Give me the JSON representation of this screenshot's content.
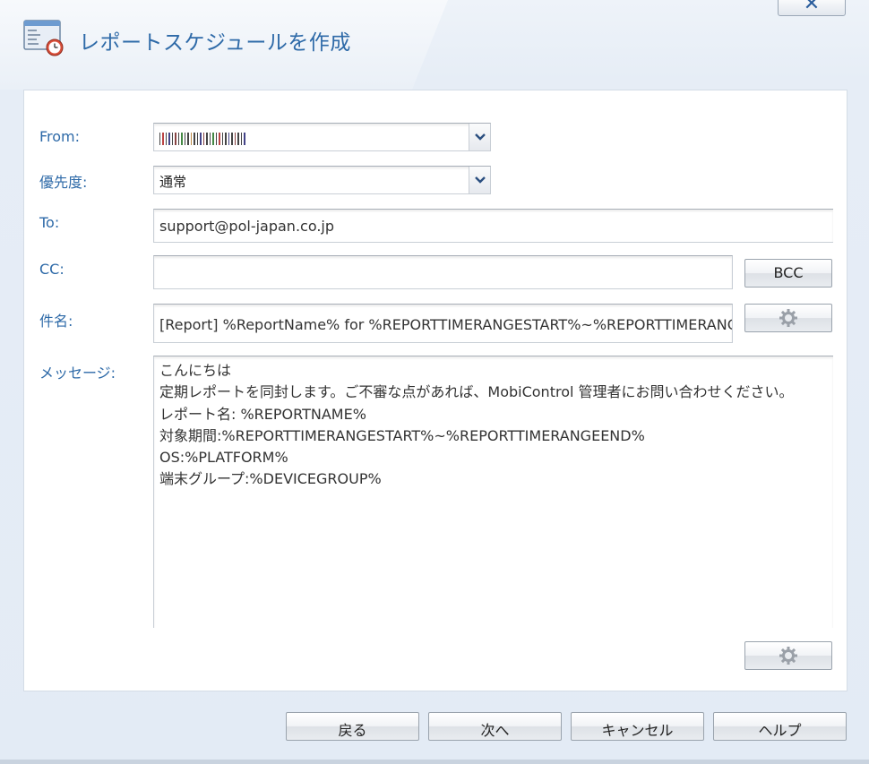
{
  "dialog": {
    "title": "レポートスケジュールを作成",
    "close_label": "✕"
  },
  "form": {
    "from_label": "From:",
    "from_value": "",
    "priority_label": "優先度:",
    "priority_value": "通常",
    "to_label": "To:",
    "to_value": "support@pol-japan.co.jp",
    "cc_label": "CC:",
    "cc_value": "",
    "bcc_button": "BCC",
    "subject_label": "件名:",
    "subject_value": "[Report] %ReportName% for %REPORTTIMERANGESTART%~%REPORTTIMERANGEEND%",
    "message_label": "メッセージ:",
    "message_lines": [
      "こんにちは",
      "定期レポートを同封します。ご不審な点があれば、MobiControl 管理者にお問い合わせください。",
      "レポート名: %REPORTNAME%",
      "対象期間:%REPORTTIMERANGESTART%~%REPORTTIMERANGEEND%",
      "OS:%PLATFORM%",
      "端末グループ:%DEVICEGROUP%"
    ]
  },
  "footer": {
    "back": "戻る",
    "next": "次へ",
    "cancel": "キャンセル",
    "help": "ヘルプ"
  },
  "colors": {
    "label": "#2e6aa8",
    "title": "#2e6aa8",
    "panel": "#ffffff",
    "background": "#e3ebf5"
  }
}
